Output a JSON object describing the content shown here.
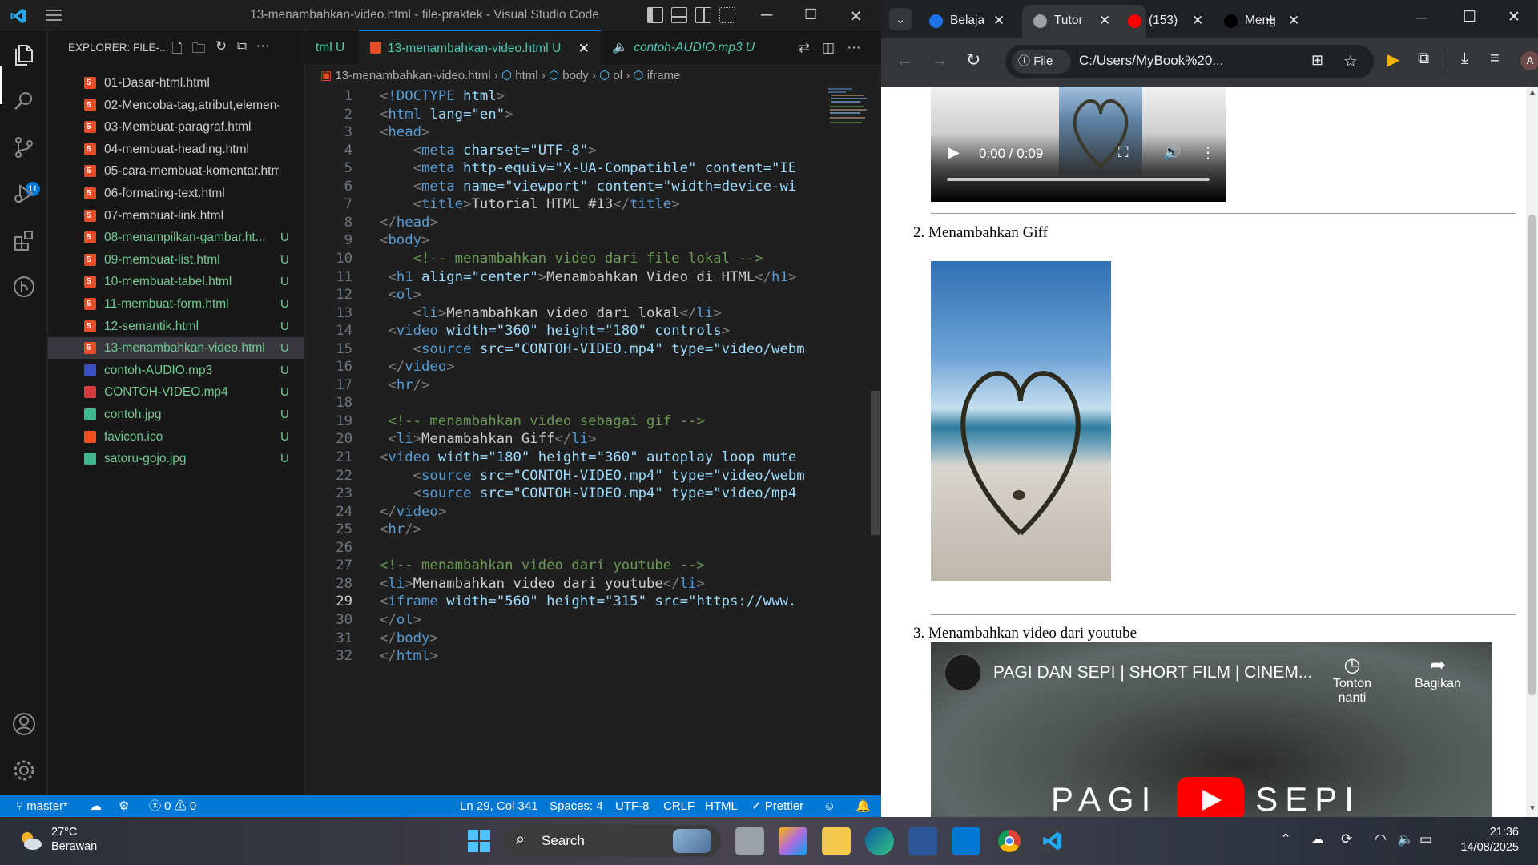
{
  "vscode": {
    "window_title": "13-menambahkan-video.html - file-praktek - Visual Studio Code",
    "explorer_header": "EXPLORER: FILE-...",
    "source_control_badge": "11",
    "files": [
      {
        "name": "01-Dasar-html.html",
        "icon": "html5-icon",
        "status": ""
      },
      {
        "name": "02-Mencoba-tag,atribut,elemen-...",
        "icon": "html5-icon",
        "status": ""
      },
      {
        "name": "03-Membuat-paragraf.html",
        "icon": "html5-icon",
        "status": ""
      },
      {
        "name": "04-membuat-heading.html",
        "icon": "html5-icon",
        "status": ""
      },
      {
        "name": "05-cara-membuat-komentar.html",
        "icon": "html5-icon",
        "status": ""
      },
      {
        "name": "06-formating-text.html",
        "icon": "html5-icon",
        "status": ""
      },
      {
        "name": "07-membuat-link.html",
        "icon": "html5-icon",
        "status": ""
      },
      {
        "name": "08-menampilkan-gambar.ht...",
        "icon": "html5-icon",
        "status": "U"
      },
      {
        "name": "09-membuat-list.html",
        "icon": "html5-icon",
        "status": "U"
      },
      {
        "name": "10-membuat-tabel.html",
        "icon": "html5-icon",
        "status": "U"
      },
      {
        "name": "11-membuat-form.html",
        "icon": "html5-icon",
        "status": "U"
      },
      {
        "name": "12-semantik.html",
        "icon": "html5-icon",
        "status": "U"
      },
      {
        "name": "13-menambahkan-video.html",
        "icon": "html5-icon",
        "status": "U"
      },
      {
        "name": "contoh-AUDIO.mp3",
        "icon": "audio-icon",
        "status": "U"
      },
      {
        "name": "CONTOH-VIDEO.mp4",
        "icon": "video-file-icon",
        "status": "U"
      },
      {
        "name": "contoh.jpg",
        "icon": "image-icon",
        "status": "U"
      },
      {
        "name": "favicon.ico",
        "icon": "star-icon",
        "status": "U"
      },
      {
        "name": "satoru-gojo.jpg",
        "icon": "image-icon",
        "status": "U"
      }
    ],
    "tabs": [
      {
        "label": "tml",
        "status": "U"
      },
      {
        "label": "13-menambahkan-video.html",
        "status": "U"
      },
      {
        "label": "contoh-AUDIO.mp3",
        "status": "U"
      }
    ],
    "breadcrumb": [
      "13-menambahkan-video.html",
      "html",
      "body",
      "ol",
      "iframe"
    ],
    "current_line": 29,
    "statusbar": {
      "branch": "master*",
      "problems": "0",
      "warnings": "0",
      "cursor": "Ln 29, Col 341",
      "spaces": "Spaces: 4",
      "encoding": "UTF-8",
      "eol": "CRLF",
      "language": "HTML",
      "formatter": "Prettier"
    }
  },
  "code_lines": [
    "<!DOCTYPE html>",
    "<html lang=\"en\">",
    "<head>",
    "    <meta charset=\"UTF-8\">",
    "    <meta http-equiv=\"X-UA-Compatible\" content=\"IE",
    "    <meta name=\"viewport\" content=\"width=device-wi",
    "    <title>Tutorial HTML #13</title>",
    "</head>",
    "<body>",
    "    <!-- menambahkan video dari file lokal -->",
    " <h1 align=\"center\">Menambahkan Video di HTML</h1>",
    " <ol>",
    "    <li>Menambahkan video dari lokal</li>",
    " <video width=\"360\" height=\"180\" controls>",
    "    <source src=\"CONTOH-VIDEO.mp4\" type=\"video/webm",
    " </video>",
    " <hr/>",
    "",
    " <!-- menambahkan video sebagai gif -->",
    " <li>Menambahkan Giff</li>",
    "<video width=\"180\" height=\"360\" autoplay loop mute",
    "    <source src=\"CONTOH-VIDEO.mp4\" type=\"video/webm",
    "    <source src=\"CONTOH-VIDEO.mp4\" type=\"video/mp4",
    "</video>",
    "<hr/>",
    "",
    "<!-- menambahkan video dari youtube -->",
    "<li>Menambahkan video dari youtube</li>",
    "<iframe width=\"560\" height=\"315\" src=\"https://www.",
    "</ol>",
    "</body>",
    "</html>"
  ],
  "chrome": {
    "tabs": [
      {
        "label": "Belaja",
        "favicon": "globe-icon",
        "color": "#1a73e8"
      },
      {
        "label": "Tutor",
        "favicon": "globe-icon",
        "color": "#9aa0a6"
      },
      {
        "label": "(153)",
        "favicon": "youtube-icon",
        "color": "#ff0000"
      },
      {
        "label": "Meng",
        "favicon": "github-icon",
        "color": "#000000"
      }
    ],
    "omnibox_scheme": "File",
    "omnibox_url": "C:/Users/MyBook%20...",
    "profile_initial": "A"
  },
  "webpage": {
    "video_time": "0:00 / 0:09",
    "item2": "Menambahkan Giff",
    "item3": "Menambahkan video dari youtube",
    "item2_num": "2.",
    "item3_num": "3.",
    "yt_title": "PAGI DAN SEPI | SHORT FILM | CINEM...",
    "yt_watch_later": "Tonton nanti",
    "yt_share": "Bagikan",
    "yt_overlay": "PAGI   N SEPI"
  },
  "taskbar": {
    "temperature": "27°C",
    "weather": "Berawan",
    "search": "Search",
    "time": "21:36",
    "date": "14/08/2025"
  }
}
